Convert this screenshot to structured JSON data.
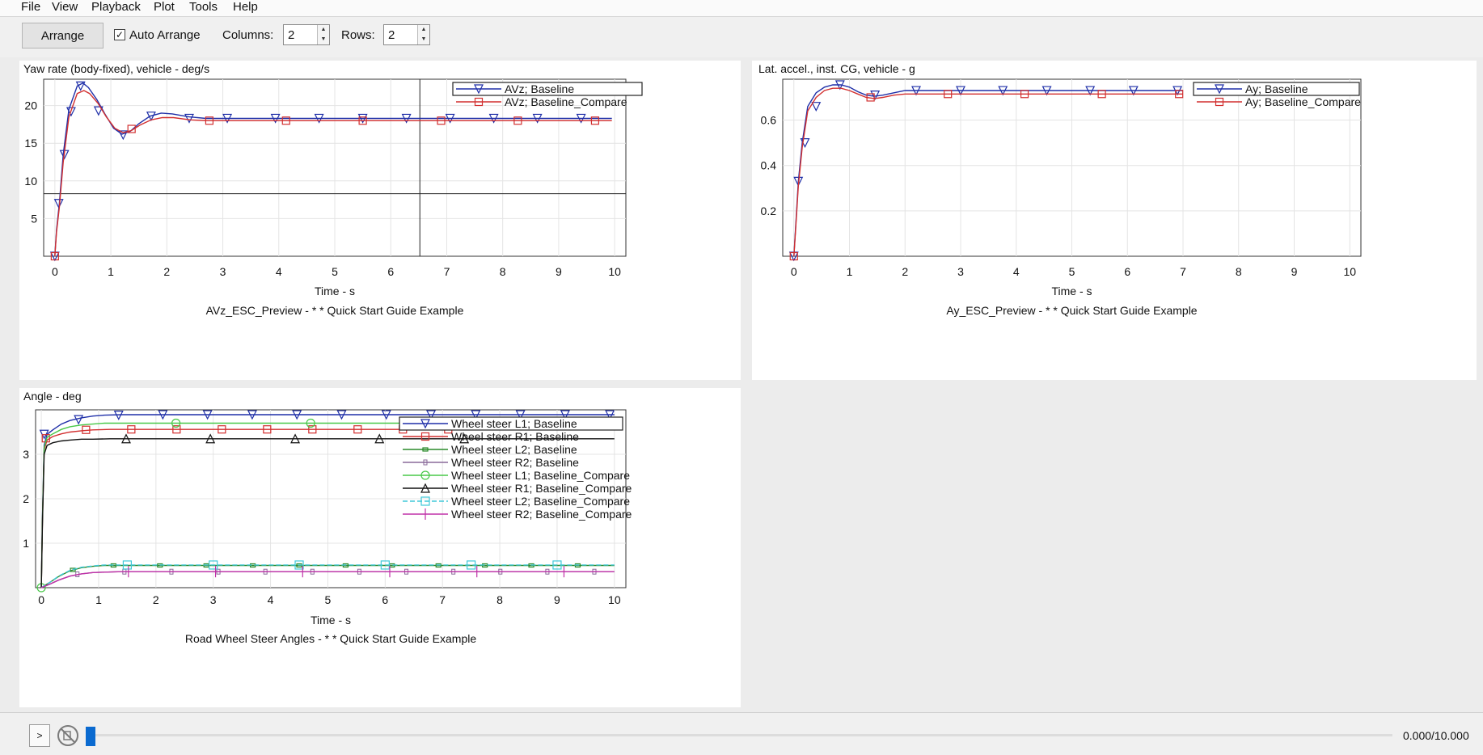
{
  "menu": [
    "File",
    "View",
    "Playback",
    "Plot",
    "Tools",
    "Help"
  ],
  "toolbar": {
    "arrange_label": "Arrange",
    "auto_arrange_label": "Auto Arrange",
    "auto_arrange_checked": "✓",
    "columns_label": "Columns:",
    "columns_value": "2",
    "rows_label": "Rows:",
    "rows_value": "2"
  },
  "plots": [
    {
      "ylabel": "Yaw rate (body-fixed), vehicle - deg/s",
      "xlabel": "Time - s",
      "caption": "AVz_ESC_Preview - * * Quick Start Guide Example",
      "legend": [
        "AVz; Baseline",
        "AVz; Baseline_Compare"
      ]
    },
    {
      "ylabel": "Lat. accel., inst. CG, vehicle - g",
      "xlabel": "Time - s",
      "caption": "Ay_ESC_Preview - * * Quick Start Guide Example",
      "legend": [
        "Ay; Baseline",
        "Ay; Baseline_Compare"
      ]
    },
    {
      "ylabel": "Angle - deg",
      "xlabel": "Time - s",
      "caption": "Road Wheel Steer Angles - * * Quick Start Guide Example",
      "legend": [
        "Wheel steer L1; Baseline",
        "Wheel steer R1; Baseline",
        "Wheel steer L2; Baseline",
        "Wheel steer R2; Baseline",
        "Wheel steer L1; Baseline_Compare",
        "Wheel steer R1; Baseline_Compare",
        "Wheel steer L2; Baseline_Compare",
        "Wheel steer R2; Baseline_Compare"
      ]
    }
  ],
  "playback": {
    "time_readout": "0.000/10.000",
    "position": 0,
    "play_icon": "▶",
    "play_symbol": ">"
  },
  "colors": {
    "blue": "#1f2fa8",
    "red": "#d22f2f",
    "green": "#2a8a2a",
    "purple": "#8a6a9a",
    "lightgreen": "#48c848",
    "black": "#111111",
    "cyan": "#40c8d8",
    "magenta": "#c030a8"
  },
  "chart_data": [
    {
      "type": "line",
      "title": "",
      "xlabel": "Time - s",
      "ylabel": "Yaw rate (body-fixed), vehicle - deg/s",
      "xlim": [
        -0.2,
        10.2
      ],
      "ylim": [
        0,
        23.5
      ],
      "xticks": [
        0,
        1,
        2,
        3,
        4,
        5,
        6,
        7,
        8,
        9,
        10
      ],
      "yticks": [
        5,
        10,
        15,
        20
      ],
      "grid": true,
      "legend_position": "top-right",
      "crosshair": {
        "x": 6.52,
        "y": 8.3
      },
      "series": [
        {
          "name": "AVz; Baseline",
          "color": "#1f2fa8",
          "marker": "triangle-down",
          "x": [
            0,
            0.03,
            0.08,
            0.15,
            0.25,
            0.4,
            0.5,
            0.6,
            0.75,
            0.9,
            1.05,
            1.2,
            1.35,
            1.5,
            1.7,
            1.9,
            2.1,
            2.4,
            2.7,
            3,
            4,
            5,
            6,
            7,
            8,
            9,
            9.95
          ],
          "y": [
            0,
            3.5,
            7,
            13.5,
            19.5,
            22.6,
            23,
            22.4,
            20.8,
            18.8,
            17,
            16.2,
            16.6,
            17.6,
            18.6,
            19,
            18.9,
            18.5,
            18.3,
            18.3,
            18.3,
            18.3,
            18.3,
            18.3,
            18.3,
            18.3,
            18.3
          ],
          "markers_x": [
            0,
            0.07,
            0.17,
            0.29,
            0.46,
            0.78,
            1.22,
            1.72,
            2.4,
            3.08,
            3.94,
            4.72,
            5.5,
            6.28,
            7.06,
            7.84,
            8.62,
            9.4
          ],
          "markers_y": [
            0,
            7,
            13.5,
            19.2,
            22.6,
            19.3,
            16.1,
            18.6,
            18.3,
            18.3,
            18.3,
            18.3,
            18.3,
            18.3,
            18.3,
            18.3,
            18.3,
            18.3
          ]
        },
        {
          "name": "AVz; Baseline_Compare",
          "color": "#d22f2f",
          "marker": "square",
          "x": [
            0,
            0.03,
            0.08,
            0.15,
            0.25,
            0.4,
            0.52,
            0.62,
            0.77,
            0.92,
            1.07,
            1.22,
            1.37,
            1.52,
            1.72,
            1.92,
            2.12,
            2.42,
            2.72,
            3,
            4,
            5,
            6,
            7,
            8,
            9,
            9.95
          ],
          "y": [
            0,
            3.2,
            6.5,
            12.5,
            18.5,
            21.6,
            22,
            21.6,
            20.3,
            18.5,
            17,
            16.4,
            16.7,
            17.4,
            18.1,
            18.4,
            18.4,
            18.1,
            18,
            18,
            18,
            18,
            18,
            18,
            18,
            18,
            18
          ],
          "markers_x": [
            0,
            1.37,
            2.76,
            4.13,
            5.5,
            6.9,
            8.27,
            9.65
          ],
          "markers_y": [
            0,
            16.9,
            18,
            18,
            18,
            18,
            18,
            18
          ]
        }
      ]
    },
    {
      "type": "line",
      "title": "",
      "xlabel": "Time - s",
      "ylabel": "Lat. accel., inst. CG, vehicle - g",
      "xlim": [
        -0.2,
        10.2
      ],
      "ylim": [
        0,
        0.78
      ],
      "xticks": [
        0,
        1,
        2,
        3,
        4,
        5,
        6,
        7,
        8,
        9,
        10
      ],
      "yticks": [
        0.2,
        0.4,
        0.6
      ],
      "grid": true,
      "legend_position": "top-right",
      "series": [
        {
          "name": "Ay; Baseline",
          "color": "#1f2fa8",
          "marker": "triangle-down",
          "x": [
            0,
            0.03,
            0.08,
            0.15,
            0.25,
            0.4,
            0.55,
            0.7,
            0.85,
            1,
            1.15,
            1.3,
            1.45,
            1.6,
            1.8,
            2.0,
            2.3,
            2.6,
            3,
            4,
            5,
            6,
            7
          ],
          "y": [
            0,
            0.12,
            0.33,
            0.5,
            0.66,
            0.72,
            0.745,
            0.755,
            0.755,
            0.745,
            0.725,
            0.71,
            0.705,
            0.71,
            0.72,
            0.73,
            0.73,
            0.73,
            0.73,
            0.73,
            0.73,
            0.73,
            0.73
          ],
          "markers_x": [
            0,
            0.08,
            0.2,
            0.4,
            0.83,
            1.46,
            2.2,
            3.0,
            3.76,
            4.55,
            5.33,
            6.11,
            6.9
          ],
          "markers_y": [
            0,
            0.33,
            0.5,
            0.66,
            0.755,
            0.71,
            0.73,
            0.73,
            0.73,
            0.73,
            0.73,
            0.73,
            0.73
          ]
        },
        {
          "name": "Ay; Baseline_Compare",
          "color": "#d22f2f",
          "marker": "square",
          "x": [
            0,
            0.03,
            0.08,
            0.15,
            0.25,
            0.4,
            0.55,
            0.7,
            0.85,
            1,
            1.15,
            1.3,
            1.45,
            1.6,
            1.8,
            2.0,
            2.3,
            2.6,
            3,
            4,
            5,
            6,
            7
          ],
          "y": [
            0,
            0.11,
            0.31,
            0.48,
            0.64,
            0.7,
            0.73,
            0.74,
            0.74,
            0.73,
            0.715,
            0.7,
            0.695,
            0.7,
            0.71,
            0.715,
            0.715,
            0.715,
            0.715,
            0.715,
            0.715,
            0.715,
            0.715
          ],
          "markers_x": [
            0,
            1.38,
            2.77,
            4.15,
            5.54,
            6.93
          ],
          "markers_y": [
            0,
            0.7,
            0.715,
            0.715,
            0.715,
            0.715
          ]
        }
      ]
    },
    {
      "type": "line",
      "title": "",
      "xlabel": "Time - s",
      "ylabel": "Angle - deg",
      "xlim": [
        -0.1,
        10.2
      ],
      "ylim": [
        0,
        4.0
      ],
      "xticks": [
        0,
        1,
        2,
        3,
        4,
        5,
        6,
        7,
        8,
        9,
        10
      ],
      "yticks": [
        1,
        2,
        3
      ],
      "grid": true,
      "legend_position": "top-right",
      "series": [
        {
          "name": "Wheel steer L1; Baseline",
          "color": "#1f2fa8",
          "marker": "triangle-down",
          "x": [
            0,
            0.02,
            0.05,
            0.1,
            0.2,
            0.35,
            0.5,
            0.7,
            0.9,
            1.1,
            1.4,
            2,
            10
          ],
          "y": [
            0,
            1.6,
            3.2,
            3.45,
            3.55,
            3.68,
            3.76,
            3.82,
            3.86,
            3.88,
            3.89,
            3.89,
            3.89
          ],
          "markers_x": [
            0.05,
            0.65,
            1.35,
            2.12,
            2.9,
            3.68,
            4.46,
            5.24,
            6.02,
            6.8,
            7.58,
            8.36,
            9.14,
            9.92
          ],
          "markers_y": [
            3.45,
            3.78,
            3.88,
            3.89,
            3.89,
            3.89,
            3.89,
            3.89,
            3.89,
            3.89,
            3.89,
            3.89,
            3.89,
            3.89
          ]
        },
        {
          "name": "Wheel steer R1; Baseline",
          "color": "#d22f2f",
          "marker": "square",
          "x": [
            0,
            0.02,
            0.05,
            0.1,
            0.2,
            0.35,
            0.5,
            0.7,
            0.9,
            1.2,
            2,
            10
          ],
          "y": [
            0,
            1.5,
            3.1,
            3.32,
            3.4,
            3.46,
            3.5,
            3.53,
            3.55,
            3.56,
            3.56,
            3.56
          ],
          "markers_x": [
            0.08,
            0.78,
            1.57,
            2.36,
            3.15,
            3.94,
            4.73,
            5.52,
            6.31,
            7.1
          ],
          "markers_y": [
            3.36,
            3.55,
            3.56,
            3.56,
            3.56,
            3.56,
            3.56,
            3.56,
            3.56,
            3.56
          ]
        },
        {
          "name": "Wheel steer L2; Baseline",
          "color": "#2a8a2a",
          "marker": "small-square",
          "x": [
            0,
            0.15,
            0.3,
            0.5,
            0.7,
            0.9,
            1.1,
            1.4,
            2,
            10
          ],
          "y": [
            0,
            0.12,
            0.25,
            0.38,
            0.45,
            0.48,
            0.5,
            0.5,
            0.5,
            0.5
          ],
          "markers_x": [
            0.55,
            1.26,
            2.07,
            2.88,
            3.69,
            4.5,
            5.31,
            6.12,
            6.93,
            7.74,
            8.55,
            9.36
          ],
          "markers_y": [
            0.4,
            0.5,
            0.5,
            0.5,
            0.5,
            0.5,
            0.5,
            0.5,
            0.5,
            0.5,
            0.5,
            0.5
          ]
        },
        {
          "name": "Wheel steer R2; Baseline",
          "color": "#8a6a9a",
          "marker": "thin-square",
          "x": [
            0,
            0.15,
            0.3,
            0.5,
            0.7,
            0.9,
            1.1,
            1.4,
            2,
            10
          ],
          "y": [
            0,
            0.08,
            0.17,
            0.26,
            0.31,
            0.34,
            0.35,
            0.36,
            0.36,
            0.36
          ],
          "markers_x": [
            0.63,
            1.45,
            2.27,
            3.09,
            3.91,
            4.73,
            5.55,
            6.37,
            7.19,
            8.01,
            8.83,
            9.65
          ],
          "markers_y": [
            0.3,
            0.36,
            0.36,
            0.36,
            0.36,
            0.36,
            0.36,
            0.36,
            0.36,
            0.36,
            0.36,
            0.36
          ]
        },
        {
          "name": "Wheel steer L1; Baseline_Compare",
          "color": "#48c848",
          "marker": "circle",
          "x": [
            0,
            0.02,
            0.05,
            0.1,
            0.2,
            0.35,
            0.5,
            0.7,
            0.9,
            1.1,
            1.4,
            2,
            10
          ],
          "y": [
            0,
            1.55,
            3.15,
            3.38,
            3.46,
            3.56,
            3.62,
            3.66,
            3.68,
            3.7,
            3.7,
            3.7,
            3.7
          ],
          "markers_x": [
            0,
            2.35,
            4.7,
            7.05
          ],
          "markers_y": [
            0,
            3.7,
            3.7,
            3.7
          ]
        },
        {
          "name": "Wheel steer R1; Baseline_Compare",
          "color": "#111111",
          "marker": "triangle-up",
          "x": [
            0,
            0.02,
            0.05,
            0.1,
            0.2,
            0.35,
            0.5,
            0.7,
            0.9,
            1.2,
            2,
            10
          ],
          "y": [
            0,
            1.45,
            3.0,
            3.2,
            3.26,
            3.3,
            3.32,
            3.34,
            3.34,
            3.35,
            3.35,
            3.35
          ],
          "markers_x": [
            1.48,
            2.95,
            4.43,
            5.9,
            7.38
          ],
          "markers_y": [
            3.35,
            3.35,
            3.35,
            3.35,
            3.35
          ]
        },
        {
          "name": "Wheel steer L2; Baseline_Compare",
          "color": "#40c8d8",
          "marker": "square-dashed",
          "x": [
            0,
            0.15,
            0.3,
            0.5,
            0.7,
            0.9,
            1.1,
            1.4,
            2,
            10
          ],
          "y": [
            0,
            0.12,
            0.26,
            0.39,
            0.46,
            0.49,
            0.51,
            0.51,
            0.51,
            0.51
          ],
          "markers_x": [
            1.5,
            3.0,
            4.5,
            6.0,
            7.5,
            9.0
          ],
          "markers_y": [
            0.51,
            0.51,
            0.51,
            0.51,
            0.51,
            0.51
          ]
        },
        {
          "name": "Wheel steer R2; Baseline_Compare",
          "color": "#c030a8",
          "marker": "vertical-bar",
          "x": [
            0,
            0.15,
            0.3,
            0.5,
            0.7,
            0.9,
            1.1,
            1.4,
            2,
            10
          ],
          "y": [
            0,
            0.08,
            0.17,
            0.26,
            0.31,
            0.34,
            0.35,
            0.36,
            0.36,
            0.36
          ],
          "markers_x": [
            1.52,
            3.04,
            4.56,
            6.08,
            7.6,
            9.12
          ],
          "markers_y": [
            0.36,
            0.36,
            0.36,
            0.36,
            0.36,
            0.36
          ]
        }
      ]
    }
  ]
}
